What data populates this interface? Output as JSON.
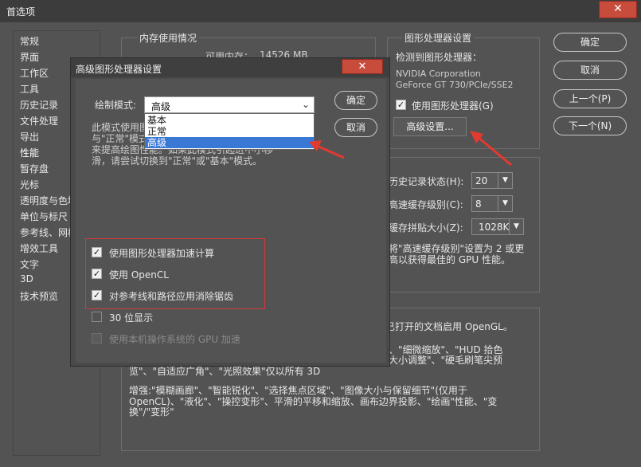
{
  "window": {
    "title": "首选项",
    "close_glyph": "✕"
  },
  "nav": {
    "items": [
      "常规",
      "界面",
      "工作区",
      "工具",
      "历史记录",
      "文件处理",
      "导出",
      "性能",
      "暂存盘",
      "光标",
      "透明度与色域",
      "单位与标尺",
      "参考线、网格和切片",
      "增效工具",
      "文字",
      "3D",
      "技术预览"
    ],
    "active_index": 7
  },
  "memory": {
    "title": "内存使用情况",
    "available_label": "可用内存：",
    "available_value": "14526 MB"
  },
  "gpu": {
    "title": "图形处理器设置",
    "detected_label": "检测到图形处理器：",
    "vendor": "NVIDIA Corporation",
    "model": "GeForce GT 730/PCIe/SSE2",
    "use_gpu_label": "使用图形处理器(G)",
    "use_gpu_checked": true,
    "advanced_button": "高级设置..."
  },
  "buttons": {
    "ok": "确定",
    "cancel": "取消",
    "prev": "上一个(P)",
    "next": "下一个(N)"
  },
  "history": {
    "states_label": "历史记录状态(H):",
    "states_value": "20",
    "cache_levels_label": "高速缓存级别(C):",
    "cache_levels_value": "8",
    "tile_size_label": "缓存拼贴大小(Z):",
    "tile_size_value": "1028K",
    "note_line1": "将\"高速缓存级别\"设置为 2 或更",
    "note_line2": "高以获得最佳的 GPU 性能。"
  },
  "description": {
    "line1": "已打开的文档启用 OpenGL。",
    "line2": "、\"细微缩放\"、\"HUD 拾色",
    "line3": "大小调整\"、\"硬毛刷笔尖预",
    "line4": "览\"、\"自适应广角\"、\"光照效果\"仅以所有 3D",
    "line5": "增强:\"模糊画廊\"、\"智能锐化\"、\"选择焦点区域\"、\"图像大小与保留细节\"(仅用于",
    "line6": "OpenCL)、\"液化\"、\"操控变形\"、平滑的平移和缩放、画布边界投影、\"绘画\"性能、\"变",
    "line7": "换\"/\"变形\""
  },
  "dialog": {
    "title": "高级图形处理器设置",
    "close_glyph": "✕",
    "mode_label": "绘制模式:",
    "mode_value": "高级",
    "dropdown_options": [
      "基本",
      "正常",
      "高级"
    ],
    "selected_option_index": 2,
    "desc_line1": "此模式使用图",
    "desc_line2": "与\"正常\"模式",
    "desc_line3": "来提高绘图性能。如果此模式引起进不小移",
    "desc_line4": "滑，请尝试切换到\"正常\"或\"基本\"模式。",
    "ok": "确定",
    "cancel": "取消",
    "options": [
      {
        "label": "使用图形处理器加速计算",
        "checked": true
      },
      {
        "label": "使用 OpenCL",
        "checked": true
      },
      {
        "label": "对参考线和路径应用消除锯齿",
        "checked": true
      },
      {
        "label": "30 位显示",
        "checked": false
      },
      {
        "label": "使用本机操作系统的 GPU 加速",
        "checked": false,
        "disabled": true
      }
    ]
  },
  "colors": {
    "annotation": "#e23a2f",
    "dropdown_highlight": "#3a78d6",
    "close_button": "#c74c3c"
  }
}
